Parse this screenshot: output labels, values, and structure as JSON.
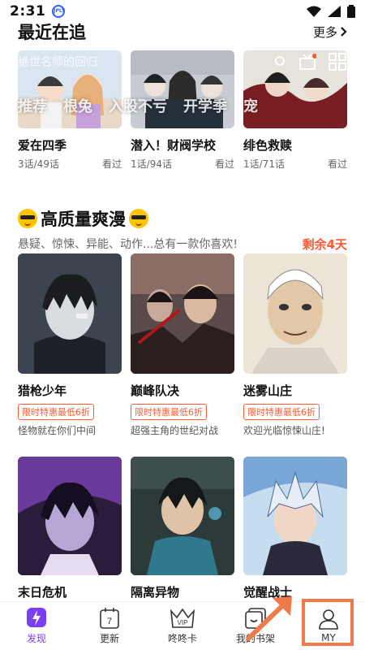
{
  "status": {
    "time": "2:31",
    "app_badge": "JPLY"
  },
  "recent": {
    "title": "最近在追",
    "more": "更多",
    "overlay_texts": [
      "推荐",
      "根兔",
      "入股不亏",
      "开学季",
      "宠"
    ],
    "overlay_faint": "绝世名师的回归",
    "items": [
      {
        "title": "爱在四季",
        "progress": "3话/49话",
        "status": "看过"
      },
      {
        "title": "潜入！财阀学校",
        "progress": "1话/94话",
        "status": "看过"
      },
      {
        "title": "绯色救赎",
        "progress": "1话/71话",
        "status": "看过"
      }
    ]
  },
  "hq": {
    "title": "高质量爽漫",
    "subtitle": "悬疑、惊悚、异能、动作...总有一款你喜欢!",
    "remaining": "剩余4天",
    "items": [
      {
        "title": "猎枪少年",
        "promo": "限时特惠最低6折",
        "desc": "怪物就在你们中间"
      },
      {
        "title": "巅峰队决",
        "promo": "限时特惠最低6折",
        "desc": "超强主角的世纪对战"
      },
      {
        "title": "迷雾山庄",
        "promo": "限时特惠最低6折",
        "desc": "欢迎光临惊悚山庄!"
      },
      {
        "title": "末日危机"
      },
      {
        "title": "隔离异物"
      },
      {
        "title": "觉醒战士"
      }
    ]
  },
  "tabs": [
    {
      "label": "发现",
      "icon": "discover-icon",
      "active": true
    },
    {
      "label": "更新",
      "icon": "calendar-icon",
      "badge": "7"
    },
    {
      "label": "咚咚卡",
      "icon": "vip-icon",
      "badge": "VIP"
    },
    {
      "label": "我的书架",
      "icon": "bookshelf-icon"
    },
    {
      "label": "MY",
      "icon": "person-icon"
    }
  ],
  "colors": {
    "accent": "#7b3ff2",
    "promo": "#ff5a36",
    "highlight": "#f07a4a"
  }
}
